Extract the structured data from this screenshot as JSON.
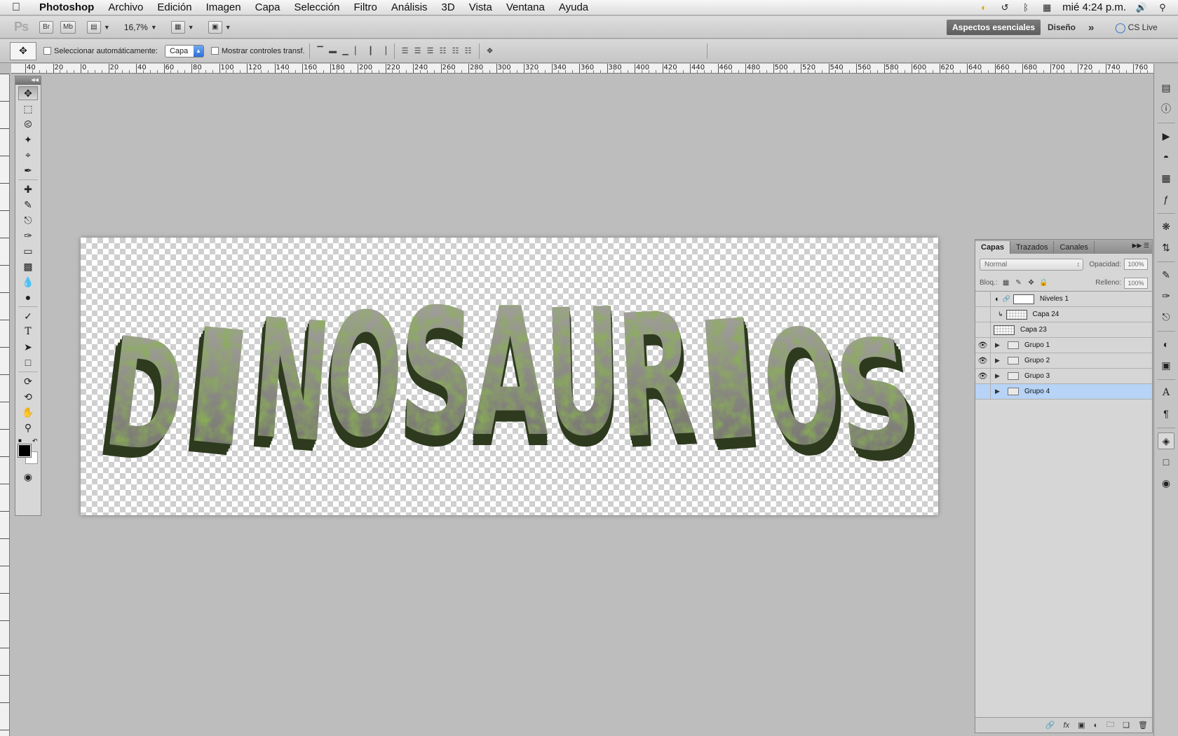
{
  "menubar": {
    "app": "Photoshop",
    "items": [
      "Archivo",
      "Edición",
      "Imagen",
      "Capa",
      "Selección",
      "Filtro",
      "Análisis",
      "3D",
      "Vista",
      "Ventana",
      "Ayuda"
    ],
    "clock": "mié 4:24 p.m."
  },
  "appbar": {
    "logo": "Ps",
    "bridge": "Br",
    "minibridge": "Mb",
    "zoom": "16,7%",
    "workspace_active": "Aspectos esenciales",
    "workspace_other": "Diseño",
    "more": "»",
    "cslive": "CS Live"
  },
  "options": {
    "auto_select_label": "Seleccionar automáticamente:",
    "auto_select_value": "Capa",
    "show_transform_label": "Mostrar controles transf."
  },
  "ruler": {
    "h_labels": [
      "40",
      "20",
      "0",
      "20",
      "40",
      "60",
      "80",
      "100",
      "120",
      "140",
      "160",
      "180",
      "200",
      "220",
      "240",
      "260",
      "280",
      "300",
      "320",
      "340",
      "360",
      "380",
      "400",
      "420",
      "440",
      "460",
      "480",
      "500",
      "520",
      "540",
      "560",
      "580",
      "600",
      "620",
      "640",
      "660",
      "680",
      "700",
      "720",
      "740",
      "760"
    ]
  },
  "canvas": {
    "text": "DINOSAURIOS"
  },
  "layers_panel": {
    "tabs": [
      "Capas",
      "Trazados",
      "Canales"
    ],
    "blend_mode": "Normal",
    "opacity_label": "Opacidad:",
    "opacity_value": "100%",
    "lock_label": "Bloq.:",
    "fill_label": "Relleno:",
    "fill_value": "100%",
    "layers": [
      {
        "name": "Niveles 1",
        "visible": false,
        "kind": "adjustment",
        "selected": false
      },
      {
        "name": "Capa 24",
        "visible": false,
        "kind": "clipped",
        "selected": false
      },
      {
        "name": "Capa 23",
        "visible": false,
        "kind": "pixel",
        "selected": false
      },
      {
        "name": "Grupo 1",
        "visible": true,
        "kind": "group",
        "selected": false
      },
      {
        "name": "Grupo 2",
        "visible": true,
        "kind": "group",
        "selected": false
      },
      {
        "name": "Grupo 3",
        "visible": true,
        "kind": "group",
        "selected": false
      },
      {
        "name": "Grupo 4",
        "visible": false,
        "kind": "group",
        "selected": true
      }
    ]
  },
  "colors": {
    "accent": "#b7d3f5",
    "moss": "#6a8f2a",
    "stone": "#8a8a84"
  }
}
